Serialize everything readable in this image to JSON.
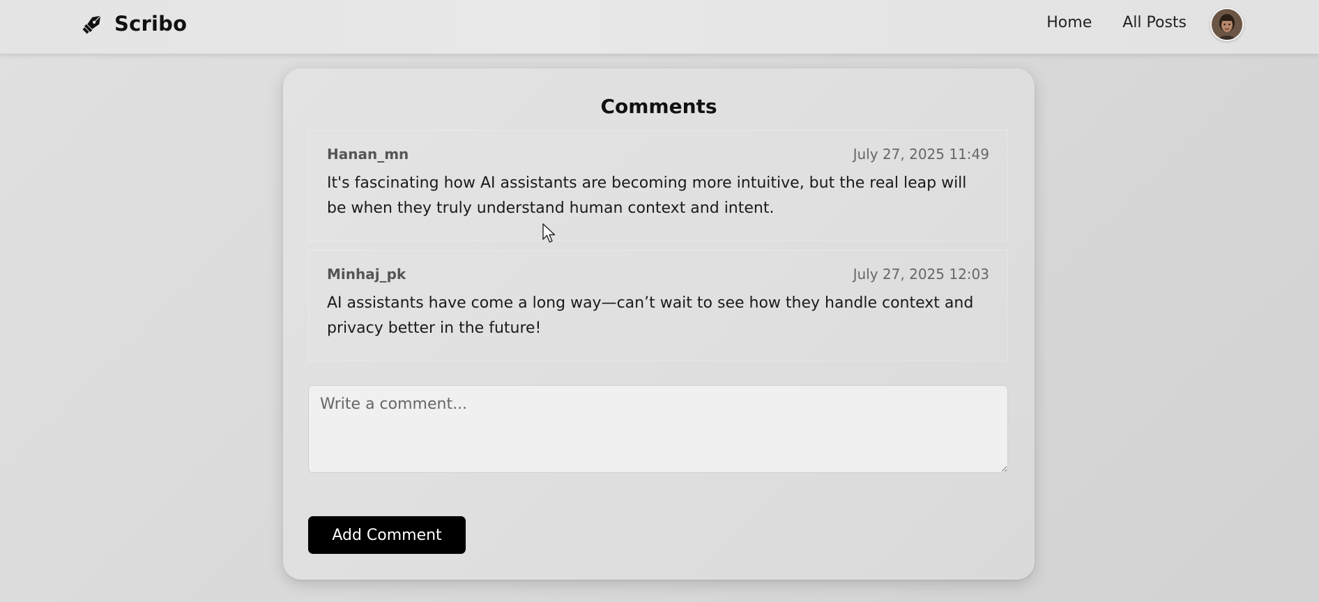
{
  "navbar": {
    "brand": "Scribo",
    "brand_icon": "pen-nib-icon",
    "links": [
      "Home",
      "All Posts"
    ],
    "avatar": "user-avatar"
  },
  "comments_section": {
    "title": "Comments",
    "comments": [
      {
        "author": "Hanan_mn",
        "timestamp": "July 27, 2025 11:49",
        "text": "It's fascinating how AI assistants are becoming more intuitive, but the real leap will be when they truly understand human context and intent."
      },
      {
        "author": "Minhaj_pk",
        "timestamp": "July 27, 2025 12:03",
        "text": "AI assistants have come a long way—can’t wait to see how they handle context and privacy better in the future!"
      }
    ],
    "input_placeholder": "Write a comment...",
    "input_value": "",
    "submit_label": "Add Comment"
  },
  "colors": {
    "button_bg": "#000000",
    "button_text": "#ffffff",
    "page_bg": "#dadada"
  }
}
